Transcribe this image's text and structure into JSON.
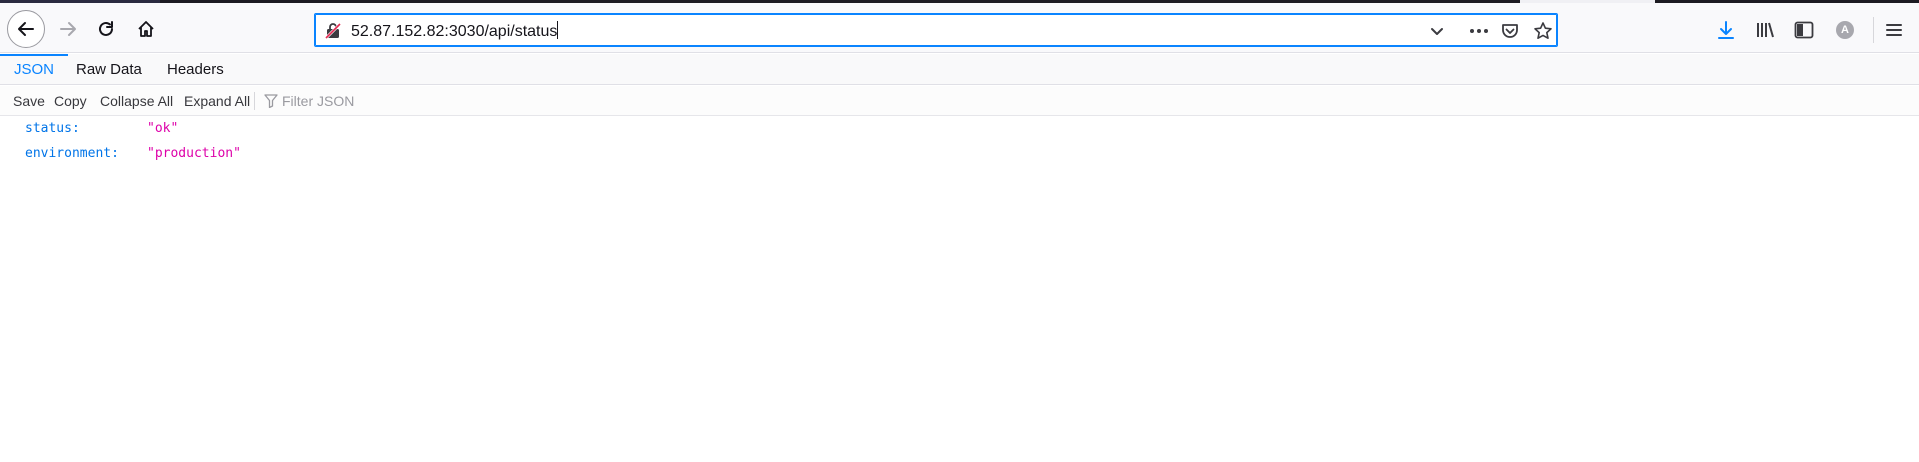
{
  "browser": {
    "url": "52.87.152.82:3030/api/status",
    "icons": [
      "back-arrow-icon",
      "forward-arrow-icon",
      "reload-icon",
      "home-icon",
      "insecure-lock-icon",
      "chevron-down-icon",
      "more-icon",
      "pocket-icon",
      "star-icon",
      "download-icon",
      "library-icon",
      "sidebar-icon",
      "account-icon",
      "hamburger-menu-icon"
    ],
    "account_initial": "A"
  },
  "viewer": {
    "tabs": [
      {
        "label": "JSON",
        "active": true
      },
      {
        "label": "Raw Data",
        "active": false
      },
      {
        "label": "Headers",
        "active": false
      }
    ],
    "toolbar": {
      "save": "Save",
      "copy": "Copy",
      "collapse_all": "Collapse All",
      "expand_all": "Expand All",
      "filter_placeholder": "Filter JSON"
    },
    "rows": [
      {
        "key": "status:",
        "value": "\"ok\""
      },
      {
        "key": "environment:",
        "value": "\"production\""
      }
    ]
  },
  "colors": {
    "accent": "#0a84ff",
    "json_key": "#0074e8",
    "json_string": "#dd00a9"
  }
}
